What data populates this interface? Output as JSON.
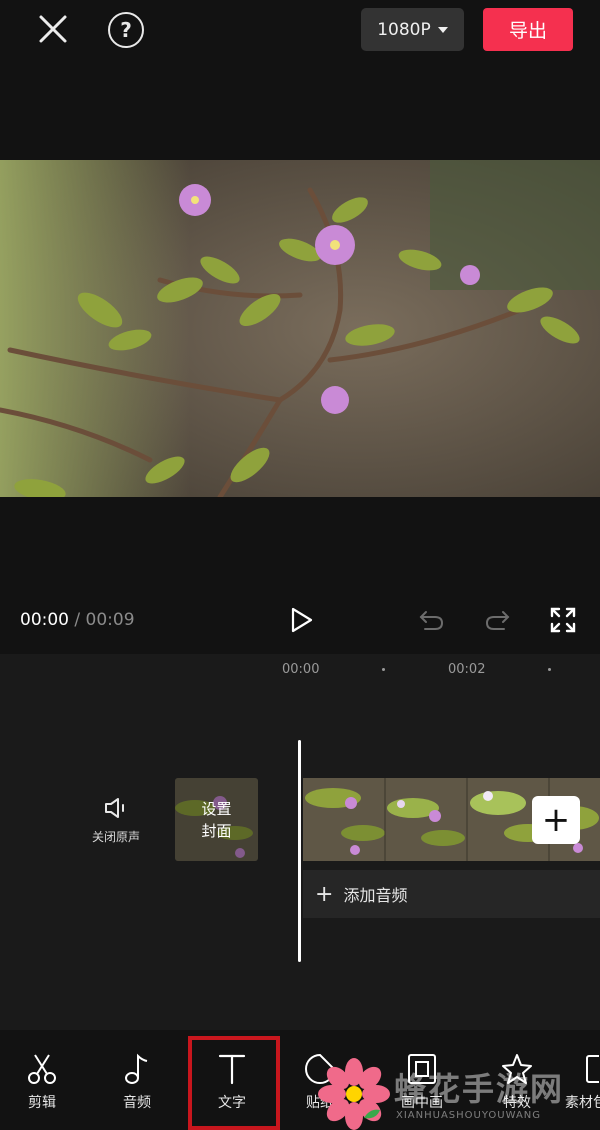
{
  "header": {
    "resolution_label": "1080P",
    "export_label": "导出",
    "help_symbol": "?"
  },
  "playback": {
    "current_time": "00:00",
    "separator": "/",
    "total_time": "00:09"
  },
  "timeline": {
    "ruler": [
      "00:00",
      "00:02"
    ],
    "mute_label": "关闭原声",
    "cover_line1": "设置",
    "cover_line2": "封面",
    "add_clip_symbol": "+",
    "add_audio_symbol": "+",
    "add_audio_label": "添加音频"
  },
  "toolbar": {
    "items": [
      {
        "label": "剪辑",
        "icon": "scissors-icon"
      },
      {
        "label": "音频",
        "icon": "music-note-icon"
      },
      {
        "label": "文字",
        "icon": "text-icon",
        "highlighted": true
      },
      {
        "label": "贴纸",
        "icon": "sticker-icon"
      },
      {
        "label": "画中画",
        "icon": "picture-in-picture-icon"
      },
      {
        "label": "特效",
        "icon": "star-effect-icon"
      },
      {
        "label": "素材包",
        "icon": "material-icon"
      }
    ]
  },
  "watermark": {
    "text": "蜂花手游网",
    "subtext": "XIANHUASHOUYOUWANG"
  },
  "colors": {
    "background": "#121212",
    "accent": "#f5304f",
    "highlight_border": "#c8161d"
  }
}
